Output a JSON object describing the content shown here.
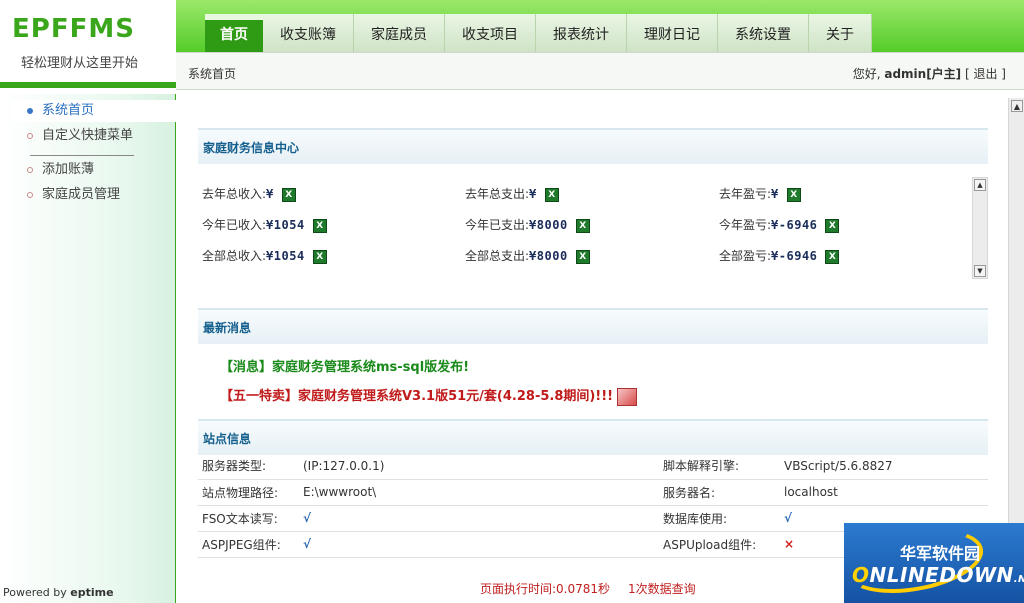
{
  "brand": {
    "logo": "EPFFMS",
    "slogan": "轻松理财从这里开始"
  },
  "nav": [
    {
      "label": "首页",
      "active": true
    },
    {
      "label": "收支账簿"
    },
    {
      "label": "家庭成员"
    },
    {
      "label": "收支项目"
    },
    {
      "label": "报表统计"
    },
    {
      "label": "理财日记"
    },
    {
      "label": "系统设置"
    },
    {
      "label": "关于"
    }
  ],
  "breadcrumb": "系统首页",
  "user": {
    "greeting": "您好,",
    "name": "admin[户主]",
    "logout": "[ 退出 ]"
  },
  "sidebar": {
    "items": [
      "系统首页",
      "自定义快捷菜单",
      "添加账薄",
      "家庭成员管理"
    ],
    "powered_prefix": "Powered by ",
    "powered_name": "eptime"
  },
  "finance": {
    "title": "家庭财务信息中心",
    "rows": [
      [
        {
          "label": "去年总收入:",
          "value": "¥"
        },
        {
          "label": "去年总支出:",
          "value": "¥"
        },
        {
          "label": "去年盈亏:",
          "value": "¥"
        }
      ],
      [
        {
          "label": "今年已收入:",
          "value": "¥1054"
        },
        {
          "label": "今年已支出:",
          "value": "¥8000"
        },
        {
          "label": "今年盈亏:",
          "value": "¥-6946"
        }
      ],
      [
        {
          "label": "全部总收入:",
          "value": "¥1054"
        },
        {
          "label": "全部总支出:",
          "value": "¥8000"
        },
        {
          "label": "全部盈亏:",
          "value": "¥-6946"
        }
      ]
    ]
  },
  "news": {
    "title": "最新消息",
    "items": [
      "【消息】家庭财务管理系统ms-sql版发布!",
      "【五一特卖】家庭财务管理系统V3.1版51元/套(4.28-5.8期间)!!!"
    ]
  },
  "site": {
    "title": "站点信息",
    "rows": [
      {
        "k1": "服务器类型:",
        "v1": "(IP:127.0.0.1)",
        "k2": "脚本解释引擎:",
        "v2": "VBScript/5.6.8827"
      },
      {
        "k1": "站点物理路径:",
        "v1": "E:\\wwwroot\\",
        "k2": "服务器名:",
        "v2": "localhost"
      },
      {
        "k1": "FSO文本读写:",
        "v1": "√",
        "k2": "数据库使用:",
        "v2": "√"
      },
      {
        "k1": "ASPJPEG组件:",
        "v1": "√",
        "k2": "ASPUpload组件:",
        "v2": "×"
      }
    ]
  },
  "footer": {
    "exec_time": "页面执行时间:0.0781秒",
    "queries": "1次数据查询"
  },
  "watermark": {
    "cn": "华军软件园",
    "en_o": "O",
    "en_rest": "NLINEDOWN",
    "en_suffix": ".NET"
  },
  "icons": {
    "xls": "excel-icon",
    "news_image": "chart-image-icon",
    "dot": "bullet-dot-icon"
  },
  "colors": {
    "brand_green": "#3aa61b",
    "nav_active": "#2f9a13",
    "panel_title": "#15608f",
    "news_green": "#1a8a1a",
    "news_red": "#c01a1a"
  }
}
